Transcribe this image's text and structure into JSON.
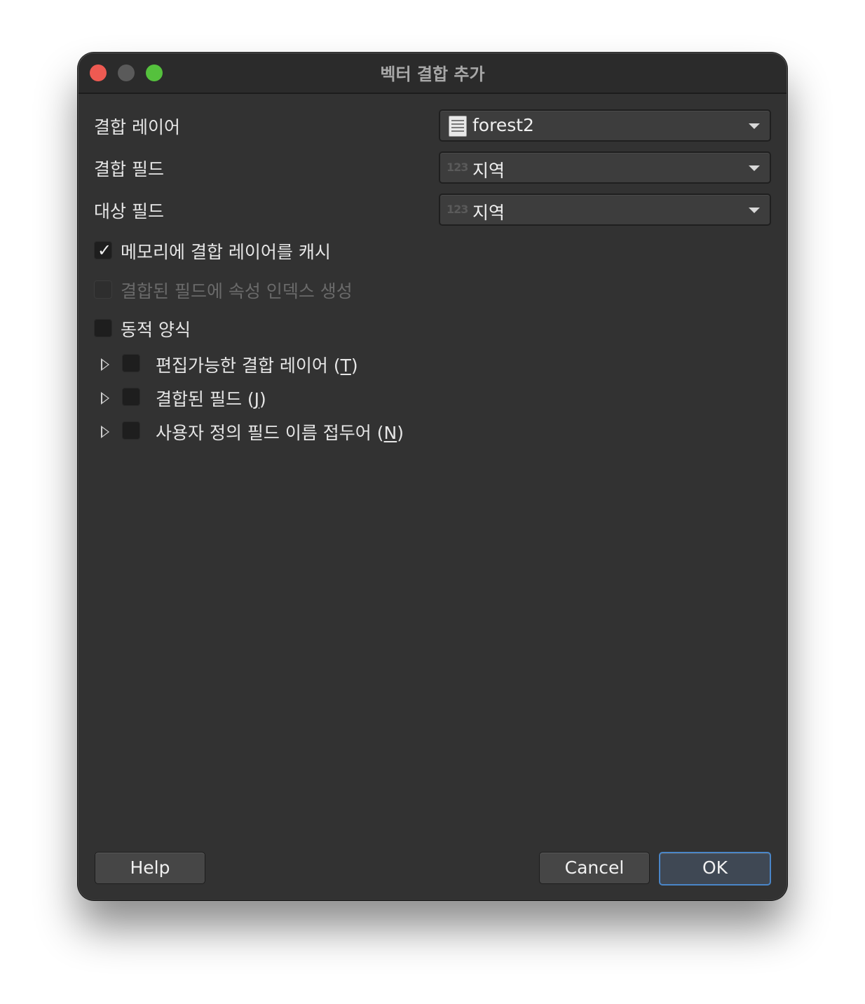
{
  "window": {
    "title": "벡터 결합 추가"
  },
  "form": {
    "join_layer": {
      "label": "결합 레이어",
      "value": "forest2",
      "icon": "table-icon"
    },
    "join_field": {
      "label": "결합 필드",
      "value": "지역",
      "icon": "123"
    },
    "target_field": {
      "label": "대상 필드",
      "value": "지역",
      "icon": "123"
    }
  },
  "options": {
    "cache": {
      "label": "메모리에 결합 레이어를 캐시",
      "checked": true
    },
    "index": {
      "label": "결합된 필드에 속성 인덱스 생성",
      "checked": false,
      "disabled": true
    },
    "dynamic": {
      "label": "동적 양식",
      "checked": false
    }
  },
  "groups": [
    {
      "label_before": "편집가능한 결합 레이어 (",
      "mnemonic": "T",
      "label_after": ")",
      "checked": false
    },
    {
      "label_before": "결합된 필드 (",
      "mnemonic": "J",
      "label_after": ")",
      "checked": false
    },
    {
      "label_before": "사용자 정의 필드 이름 접두어 (",
      "mnemonic": "N",
      "label_after": ")",
      "checked": false
    }
  ],
  "buttons": {
    "help": "Help",
    "cancel": "Cancel",
    "ok": "OK"
  },
  "colors": {
    "window_bg": "#323232",
    "accent": "#4a86c8",
    "close": "#ee5a52",
    "maximize": "#55c13d"
  }
}
